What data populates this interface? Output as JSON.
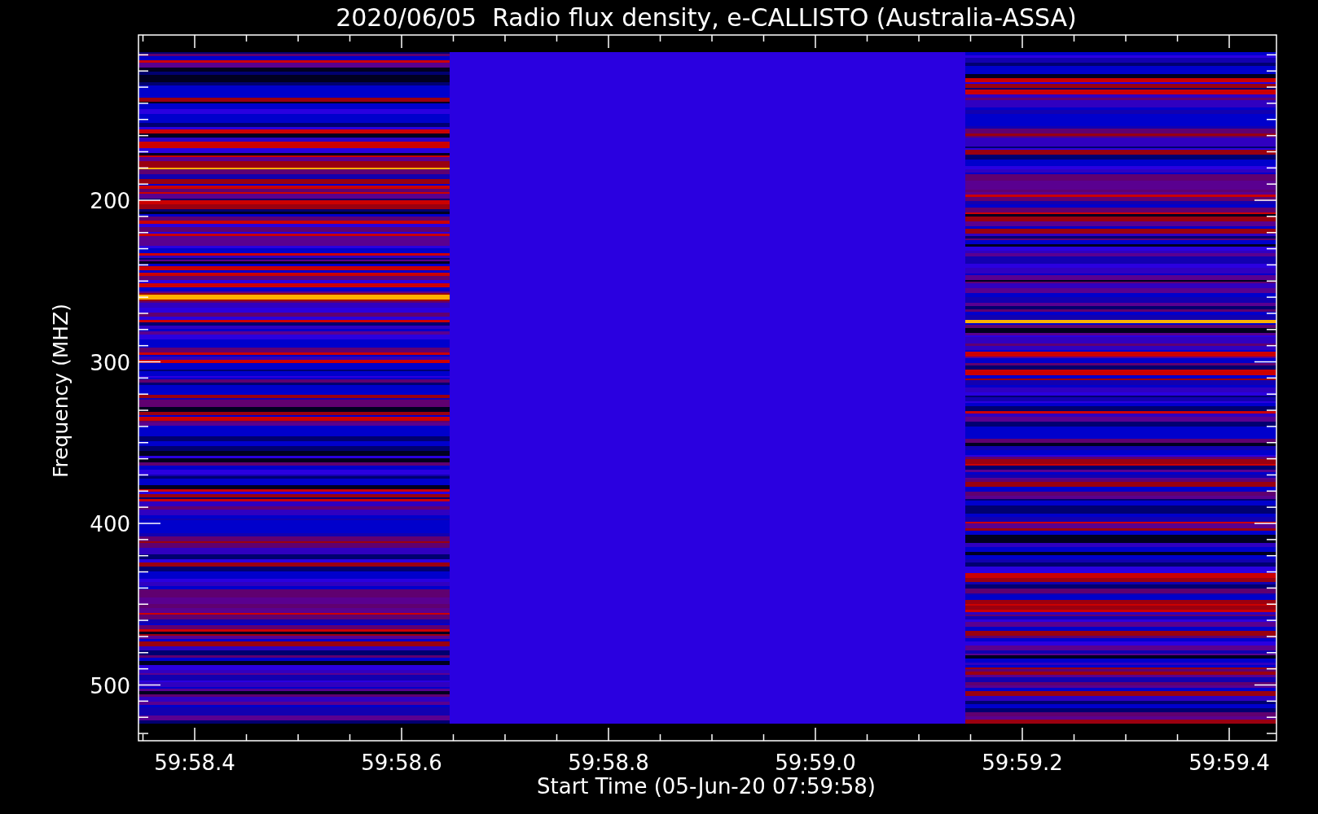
{
  "title": "2020/06/05  Radio flux density, e-CALLISTO (Australia-ASSA)",
  "plot": {
    "ylabel": "Frequency (MHZ)",
    "xlabel": "Start Time (05-Jun-20 07:59:58)",
    "yticks": [
      "200",
      "300",
      "400",
      "500"
    ],
    "xticks": [
      "59:58.4",
      "59:58.6",
      "59:58.8",
      "59:59.0",
      "59:59.2",
      "59:59.4"
    ]
  }
}
